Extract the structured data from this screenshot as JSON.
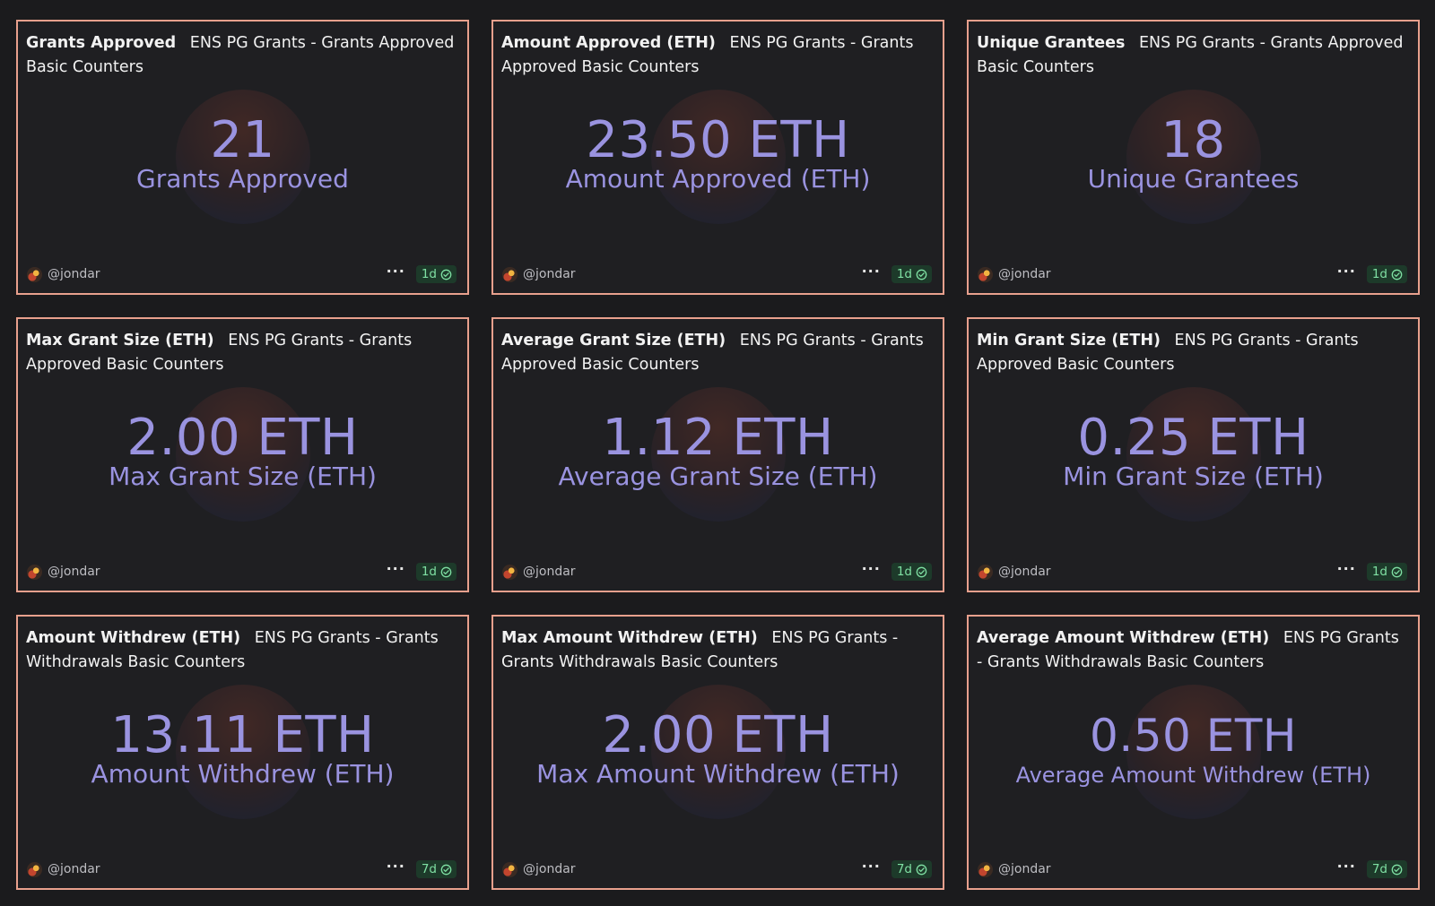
{
  "colors": {
    "background": "#1b1b1d",
    "card_background": "#1f1f22",
    "card_border": "#e8a08d",
    "counter_text": "#9a93e0",
    "badge_text": "#7fe0a3"
  },
  "cards": [
    {
      "title": "Grants Approved",
      "query": "ENS PG Grants - Grants Approved Basic Counters",
      "value": "21",
      "label": "Grants Approved",
      "author": "@jondar",
      "more": "···",
      "refresh": "1d",
      "icon": "check-circle-icon"
    },
    {
      "title": "Amount Approved (ETH)",
      "query": "ENS PG Grants - Grants Approved Basic Counters",
      "value": "23.50 ETH",
      "label": "Amount Approved (ETH)",
      "author": "@jondar",
      "more": "···",
      "refresh": "1d",
      "icon": "check-circle-icon"
    },
    {
      "title": "Unique Grantees",
      "query": "ENS PG Grants - Grants Approved Basic Counters",
      "value": "18",
      "label": "Unique Grantees",
      "author": "@jondar",
      "more": "···",
      "refresh": "1d",
      "icon": "check-circle-icon"
    },
    {
      "title": "Max Grant Size (ETH)",
      "query": "ENS PG Grants - Grants Approved Basic Counters",
      "value": "2.00 ETH",
      "label": "Max Grant Size (ETH)",
      "author": "@jondar",
      "more": "···",
      "refresh": "1d",
      "icon": "check-circle-icon"
    },
    {
      "title": "Average Grant Size (ETH)",
      "query": "ENS PG Grants - Grants Approved Basic Counters",
      "value": "1.12 ETH",
      "label": "Average Grant Size (ETH)",
      "author": "@jondar",
      "more": "···",
      "refresh": "1d",
      "icon": "check-circle-icon"
    },
    {
      "title": "Min Grant Size (ETH)",
      "query": "ENS PG Grants - Grants Approved Basic Counters",
      "value": "0.25 ETH",
      "label": "Min Grant Size (ETH)",
      "author": "@jondar",
      "more": "···",
      "refresh": "1d",
      "icon": "check-circle-icon"
    },
    {
      "title": "Amount Withdrew (ETH)",
      "query": "ENS PG Grants - Grants Withdrawals Basic Counters",
      "value": "13.11 ETH",
      "label": "Amount Withdrew (ETH)",
      "author": "@jondar",
      "more": "···",
      "refresh": "7d",
      "icon": "check-circle-icon"
    },
    {
      "title": "Max Amount Withdrew (ETH)",
      "query": "ENS PG Grants - Grants Withdrawals Basic Counters",
      "value": "2.00 ETH",
      "label": "Max Amount Withdrew (ETH)",
      "author": "@jondar",
      "more": "···",
      "refresh": "7d",
      "icon": "check-circle-icon"
    },
    {
      "title": "Average Amount Withdrew (ETH)",
      "query": "ENS PG Grants - Grants Withdrawals Basic Counters",
      "value": "0.50 ETH",
      "label": "Average Amount Withdrew (ETH)",
      "author": "@jondar",
      "more": "···",
      "refresh": "7d",
      "icon": "check-circle-icon"
    }
  ]
}
